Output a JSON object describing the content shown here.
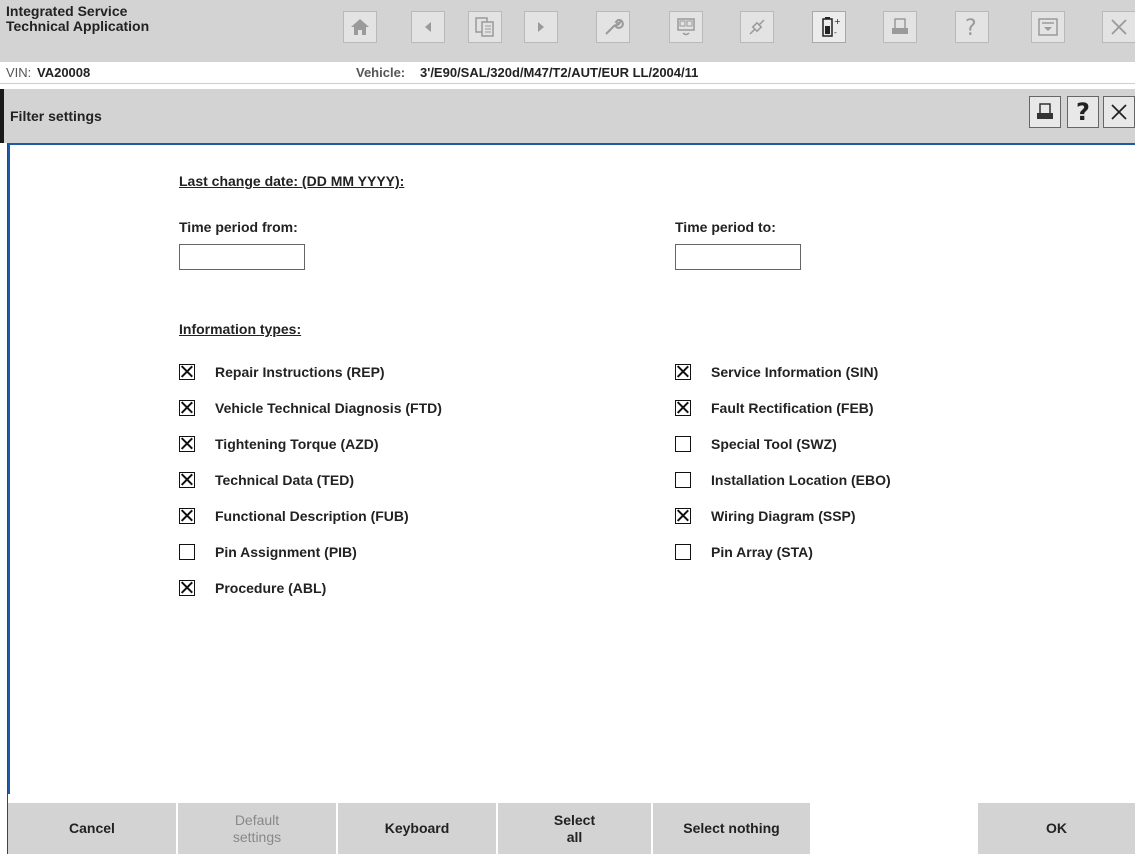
{
  "app": {
    "title_line1": "Integrated Service",
    "title_line2": "Technical Application"
  },
  "toolbar": {
    "icons": [
      "home-icon",
      "back-arrow-icon",
      "documents-icon",
      "forward-arrow-icon",
      "wrench-icon",
      "display-icon",
      "connection-icon",
      "battery-icon",
      "print-icon",
      "help-icon",
      "dropdown-icon",
      "close-icon"
    ]
  },
  "vehicle_info": {
    "vin_label": "VIN:",
    "vin_value": "VA20008",
    "vehicle_label": "Vehicle:",
    "vehicle_value": "3'/E90/SAL/320d/M47/T2/AUT/EUR LL/2004/11"
  },
  "panel": {
    "title": "Filter settings",
    "help_label": "?"
  },
  "date_section": {
    "heading": "Last change date: (DD MM YYYY):",
    "from_label": "Time period from:",
    "to_label": "Time period to:",
    "from_value": "",
    "to_value": ""
  },
  "info_types": {
    "heading": "Information types:",
    "left": [
      {
        "label": "Repair Instructions (REP)",
        "checked": true
      },
      {
        "label": "Vehicle Technical Diagnosis (FTD)",
        "checked": true
      },
      {
        "label": "Tightening Torque (AZD)",
        "checked": true
      },
      {
        "label": "Technical Data (TED)",
        "checked": true
      },
      {
        "label": "Functional Description (FUB)",
        "checked": true
      },
      {
        "label": "Pin Assignment (PIB)",
        "checked": false
      },
      {
        "label": "Procedure (ABL)",
        "checked": true
      }
    ],
    "right": [
      {
        "label": "Service Information (SIN)",
        "checked": true
      },
      {
        "label": "Fault Rectification (FEB)",
        "checked": true
      },
      {
        "label": "Special Tool (SWZ)",
        "checked": false
      },
      {
        "label": "Installation Location (EBO)",
        "checked": false
      },
      {
        "label": "Wiring Diagram (SSP)",
        "checked": true
      },
      {
        "label": "Pin Array (STA)",
        "checked": false
      }
    ]
  },
  "buttons": {
    "cancel": "Cancel",
    "default_settings": "Default\nsettings",
    "keyboard": "Keyboard",
    "select_all": "Select\nall",
    "select_nothing": "Select nothing",
    "ok": "OK"
  }
}
